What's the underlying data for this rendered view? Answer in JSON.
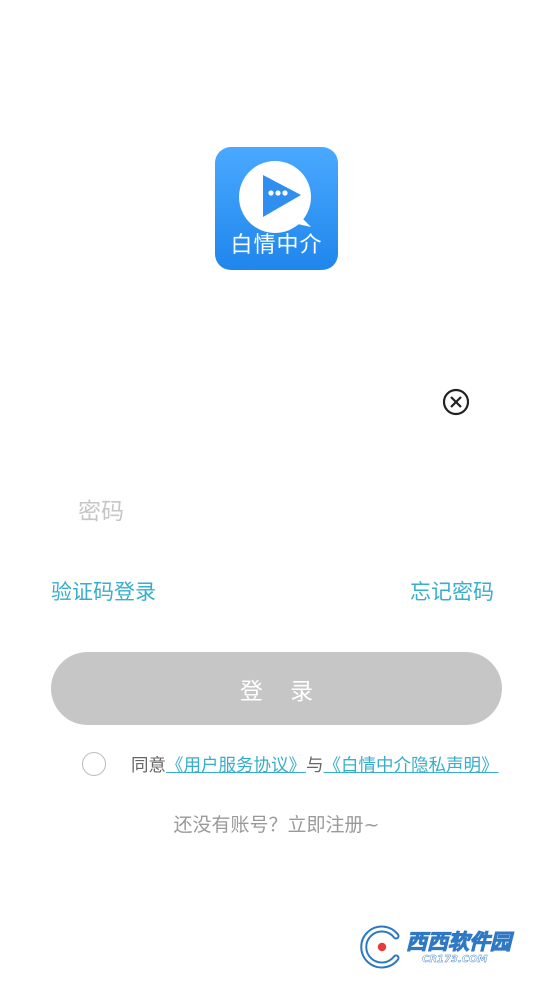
{
  "logo": {
    "text": "白情中介",
    "color": "#2e8ff0"
  },
  "clear_icon": "close-circle-icon",
  "password": {
    "placeholder": "密码",
    "value": ""
  },
  "links": {
    "sms_login": "验证码登录",
    "forgot_password": "忘记密码"
  },
  "login_button": {
    "label": "登 录",
    "disabled_color": "#c6c6c6"
  },
  "agreement": {
    "checked": false,
    "prefix": "同意",
    "terms": "《用户服务协议》",
    "joiner": "与",
    "privacy": "《白情中介隐私声明》"
  },
  "register": "还没有账号？立即注册~",
  "accent_color": "#37aecb",
  "watermark": {
    "brand": "西西软件园",
    "url": "CR173.COM"
  }
}
